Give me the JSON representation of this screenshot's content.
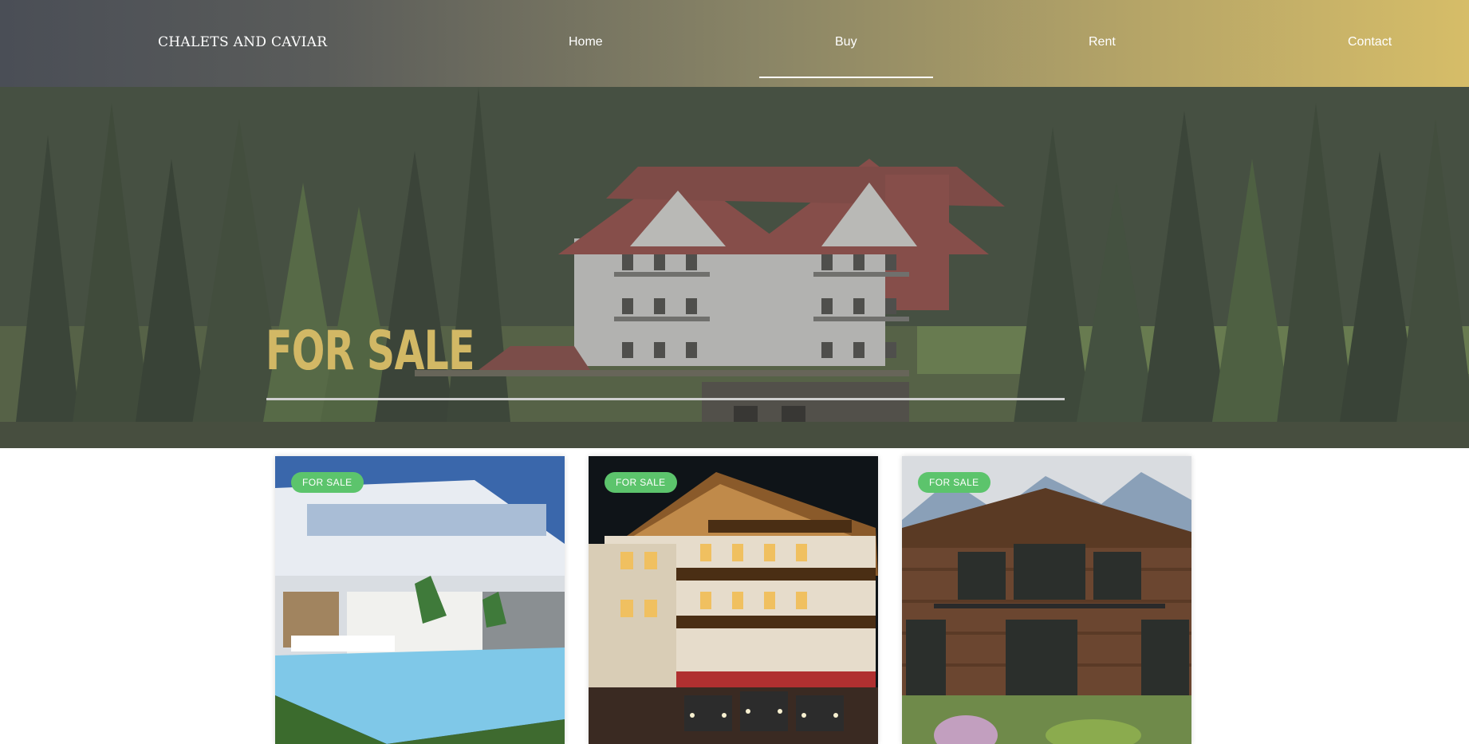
{
  "header": {
    "logo": "CHALETS AND CAVIAR",
    "nav": {
      "home": "Home",
      "buy": "Buy",
      "rent": "Rent",
      "contact": "Contact"
    },
    "active_nav": "Buy"
  },
  "hero": {
    "title": "FOR SALE",
    "title_color": "#d2b865"
  },
  "listings": [
    {
      "badge": "FOR SALE",
      "image": "modern villa with pool at dusk"
    },
    {
      "badge": "FOR SALE",
      "image": "illuminated alpine chalet at night"
    },
    {
      "badge": "FOR SALE",
      "image": "wooden mountain chalet"
    }
  ],
  "colors": {
    "header_start": "#4a4e56",
    "header_end": "#d6bd68",
    "badge": "#5cc46c"
  }
}
